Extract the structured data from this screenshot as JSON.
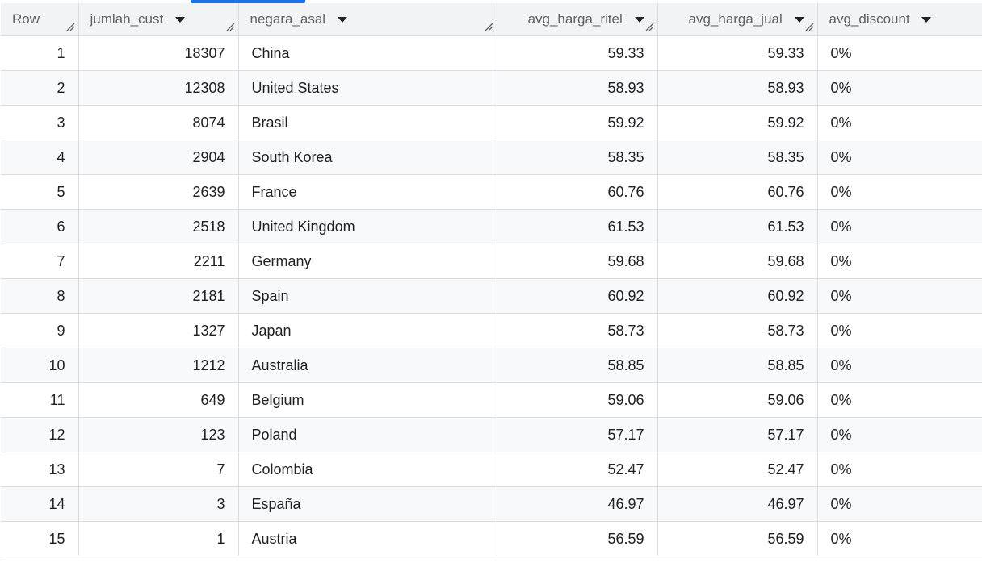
{
  "columns": [
    {
      "label": "Row"
    },
    {
      "label": "jumlah_cust"
    },
    {
      "label": "negara_asal"
    },
    {
      "label": "avg_harga_ritel"
    },
    {
      "label": "avg_harga_jual"
    },
    {
      "label": "avg_discount"
    }
  ],
  "rows": [
    {
      "row": "1",
      "jumlah_cust": "18307",
      "negara_asal": "China",
      "avg_harga_ritel": "59.33",
      "avg_harga_jual": "59.33",
      "avg_discount": "0%"
    },
    {
      "row": "2",
      "jumlah_cust": "12308",
      "negara_asal": "United States",
      "avg_harga_ritel": "58.93",
      "avg_harga_jual": "58.93",
      "avg_discount": "0%"
    },
    {
      "row": "3",
      "jumlah_cust": "8074",
      "negara_asal": "Brasil",
      "avg_harga_ritel": "59.92",
      "avg_harga_jual": "59.92",
      "avg_discount": "0%"
    },
    {
      "row": "4",
      "jumlah_cust": "2904",
      "negara_asal": "South Korea",
      "avg_harga_ritel": "58.35",
      "avg_harga_jual": "58.35",
      "avg_discount": "0%"
    },
    {
      "row": "5",
      "jumlah_cust": "2639",
      "negara_asal": "France",
      "avg_harga_ritel": "60.76",
      "avg_harga_jual": "60.76",
      "avg_discount": "0%"
    },
    {
      "row": "6",
      "jumlah_cust": "2518",
      "negara_asal": "United Kingdom",
      "avg_harga_ritel": "61.53",
      "avg_harga_jual": "61.53",
      "avg_discount": "0%"
    },
    {
      "row": "7",
      "jumlah_cust": "2211",
      "negara_asal": "Germany",
      "avg_harga_ritel": "59.68",
      "avg_harga_jual": "59.68",
      "avg_discount": "0%"
    },
    {
      "row": "8",
      "jumlah_cust": "2181",
      "negara_asal": "Spain",
      "avg_harga_ritel": "60.92",
      "avg_harga_jual": "60.92",
      "avg_discount": "0%"
    },
    {
      "row": "9",
      "jumlah_cust": "1327",
      "negara_asal": "Japan",
      "avg_harga_ritel": "58.73",
      "avg_harga_jual": "58.73",
      "avg_discount": "0%"
    },
    {
      "row": "10",
      "jumlah_cust": "1212",
      "negara_asal": "Australia",
      "avg_harga_ritel": "58.85",
      "avg_harga_jual": "58.85",
      "avg_discount": "0%"
    },
    {
      "row": "11",
      "jumlah_cust": "649",
      "negara_asal": "Belgium",
      "avg_harga_ritel": "59.06",
      "avg_harga_jual": "59.06",
      "avg_discount": "0%"
    },
    {
      "row": "12",
      "jumlah_cust": "123",
      "negara_asal": "Poland",
      "avg_harga_ritel": "57.17",
      "avg_harga_jual": "57.17",
      "avg_discount": "0%"
    },
    {
      "row": "13",
      "jumlah_cust": "7",
      "negara_asal": "Colombia",
      "avg_harga_ritel": "52.47",
      "avg_harga_jual": "52.47",
      "avg_discount": "0%"
    },
    {
      "row": "14",
      "jumlah_cust": "3",
      "negara_asal": "España",
      "avg_harga_ritel": "46.97",
      "avg_harga_jual": "46.97",
      "avg_discount": "0%"
    },
    {
      "row": "15",
      "jumlah_cust": "1",
      "negara_asal": "Austria",
      "avg_harga_ritel": "56.59",
      "avg_harga_jual": "56.59",
      "avg_discount": "0%"
    }
  ],
  "colors": {
    "accent": "#1a73e8",
    "header_bg": "#f1f3f4",
    "alt_row_bg": "#f8f9fa",
    "border": "#dadce0"
  },
  "icons": {
    "sort": "caret-down-icon",
    "resize": "column-resize-icon"
  }
}
